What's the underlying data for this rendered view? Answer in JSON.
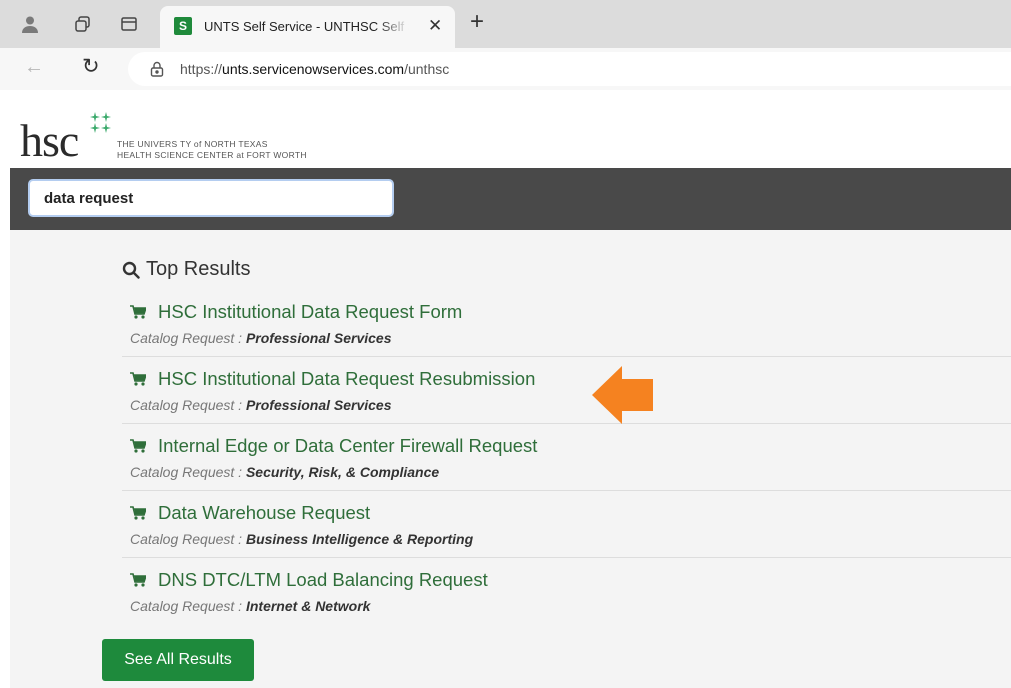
{
  "browser": {
    "tab_title": "UNTS Self Service - UNTHSC Self Service",
    "tab_favicon_text": "S",
    "url_prefix": "https://",
    "url_domain": "unts.servicenowservices.com",
    "url_path": "/unthsc"
  },
  "header": {
    "logo_text": "hsc",
    "logo_line1": "THE UNIVERS TY of NORTH TEXAS",
    "logo_line2": "HEALTH SCIENCE CENTER at FORT WORTH"
  },
  "search": {
    "value": "data request"
  },
  "results": {
    "heading": "Top Results",
    "items": [
      {
        "title": "HSC Institutional Data Request Form",
        "type": "Catalog Request",
        "category": "Professional Services"
      },
      {
        "title": "HSC Institutional Data Request Resubmission",
        "type": "Catalog Request",
        "category": "Professional Services"
      },
      {
        "title": "Internal Edge or Data Center Firewall Request",
        "type": "Catalog Request",
        "category": "Security, Risk, & Compliance"
      },
      {
        "title": "Data Warehouse Request",
        "type": "Catalog Request",
        "category": "Business Intelligence & Reporting"
      },
      {
        "title": "DNS DTC/LTM Load Balancing Request",
        "type": "Catalog Request",
        "category": "Internet & Network"
      }
    ],
    "see_all_label": "See All Results"
  },
  "annotation": {
    "arrow_color": "#f58220",
    "highlighted_item": 1
  },
  "colors": {
    "link_green": "#2f6e3a",
    "button_green": "#1e8a3c",
    "search_band": "#494949",
    "logo_dots": "#3aa96b"
  }
}
